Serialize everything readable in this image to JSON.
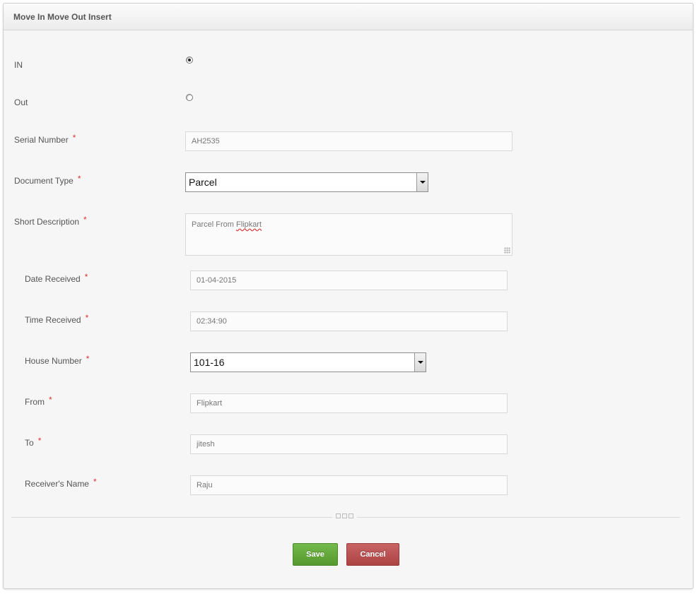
{
  "panel": {
    "title": "Move In Move Out Insert"
  },
  "direction": {
    "in_label": "IN",
    "out_label": "Out",
    "selected": "IN"
  },
  "required_marker": "*",
  "fields": {
    "serial_number": {
      "label": "Serial Number",
      "value": "AH2535"
    },
    "document_type": {
      "label": "Document Type",
      "value": "Parcel"
    },
    "short_description": {
      "label": "Short Description",
      "value_prefix": "Parcel From ",
      "value_misspelled": "Flipkart"
    },
    "date_received": {
      "label": "Date Received",
      "value": "01-04-2015"
    },
    "time_received": {
      "label": "Time Received",
      "value": "02:34:90"
    },
    "house_number": {
      "label": "House Number",
      "value": "101-16"
    },
    "from": {
      "label": "From",
      "value": "Flipkart"
    },
    "to": {
      "label": "To",
      "value": "jitesh"
    },
    "receivers_name": {
      "label": "Receiver's Name",
      "value": "Raju"
    }
  },
  "actions": {
    "save_label": "Save",
    "cancel_label": "Cancel"
  }
}
